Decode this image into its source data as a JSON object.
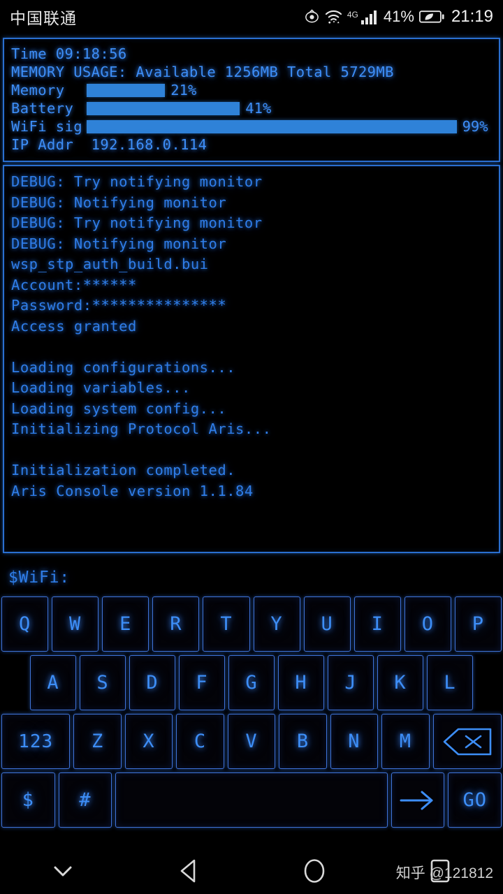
{
  "statusbar": {
    "carrier": "中国联通",
    "eye_icon": "eye-comfort-icon",
    "wifi_icon": "wifi-icon",
    "network_type": "4G",
    "signal_icon": "signal-bars-icon",
    "battery_percent": "41%",
    "battery_icon": "battery-powersave-icon",
    "clock": "21:19"
  },
  "system_panel": {
    "time_line": "Time 09:18:56",
    "memory_line": "MEMORY USAGE: Available 1256MB Total 5729MB",
    "meters": [
      {
        "label": "Memory  ",
        "value": "21%",
        "percent": 21
      },
      {
        "label": "Battery ",
        "value": "41%",
        "percent": 41
      },
      {
        "label": "WiFi sig",
        "value": "99%",
        "percent": 99
      }
    ],
    "ip_line": "IP Addr  192.168.0.114"
  },
  "console": {
    "lines": [
      "DEBUG: Try notifying monitor",
      "DEBUG: Notifying monitor",
      "DEBUG: Try notifying monitor",
      "DEBUG: Notifying monitor",
      "wsp_stp_auth_build.bui",
      "Account:******",
      "Password:***************",
      "Access granted",
      "",
      "Loading configurations...",
      "Loading variables...",
      "Loading system config...",
      "Initializing Protocol Aris...",
      "",
      "Initialization completed.",
      "Aris Console version 1.1.84"
    ]
  },
  "prompt": {
    "text": "$WiFi:",
    "value": ""
  },
  "keyboard": {
    "row1": [
      "Q",
      "W",
      "E",
      "R",
      "T",
      "Y",
      "U",
      "I",
      "O",
      "P"
    ],
    "row2": [
      "A",
      "S",
      "D",
      "F",
      "G",
      "H",
      "J",
      "K",
      "L"
    ],
    "row3_numeric": "123",
    "row3": [
      "Z",
      "X",
      "C",
      "V",
      "B",
      "N",
      "M"
    ],
    "backspace": "backspace-icon",
    "row4": {
      "dollar": "$",
      "hash": "#",
      "space": "",
      "arrow": "arrow-right-icon",
      "go": "GO"
    }
  },
  "navbar": {
    "hide_keyboard": "chevron-down-icon",
    "back": "back-triangle-icon",
    "home": "home-circle-icon",
    "recents": "recents-square-icon",
    "watermark": "知乎 @121812"
  },
  "colors": {
    "accent": "#3d8ef7",
    "border": "#2a6fd0",
    "bar_fill": "#2f82d8",
    "background": "#000000"
  }
}
